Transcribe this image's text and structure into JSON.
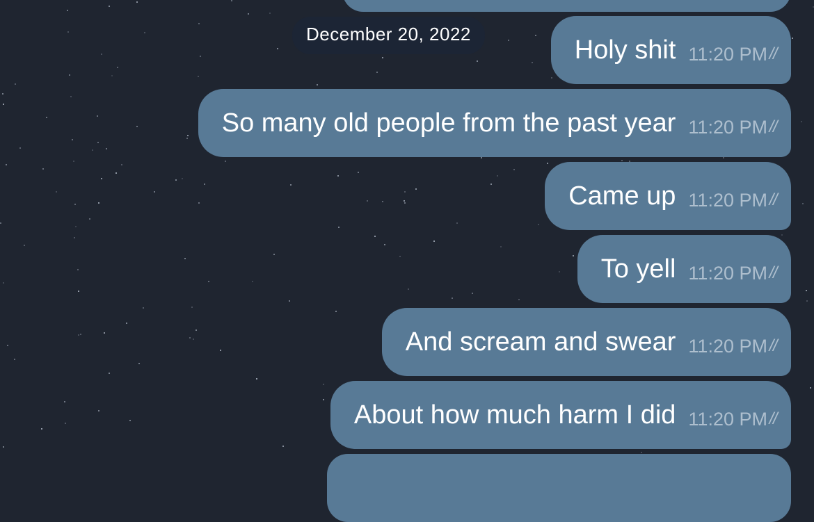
{
  "date_separator": "December 20, 2022",
  "colors": {
    "bubble": "#587a96",
    "background": "#1f2530",
    "timestamp": "#aebfce"
  },
  "messages": [
    {
      "text": "Holy shit",
      "time": "11:20 PM",
      "status": "read-double-check-icon"
    },
    {
      "text": "So many old people from the past year",
      "time": "11:20 PM",
      "status": "read-double-check-icon"
    },
    {
      "text": "Came up",
      "time": "11:20 PM",
      "status": "read-double-check-icon"
    },
    {
      "text": "To yell",
      "time": "11:20 PM",
      "status": "read-double-check-icon"
    },
    {
      "text": "And scream and swear",
      "time": "11:20 PM",
      "status": "read-double-check-icon"
    },
    {
      "text": "About how much harm I did",
      "time": "11:20 PM",
      "status": "read-double-check-icon"
    }
  ]
}
